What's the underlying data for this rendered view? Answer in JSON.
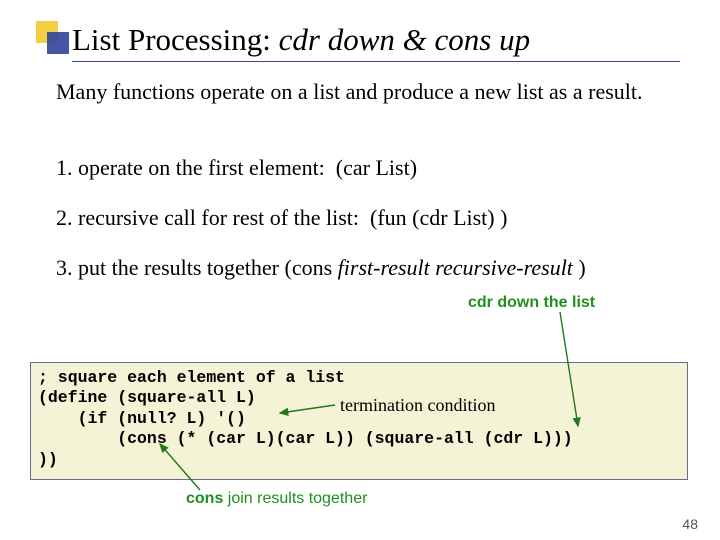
{
  "decor": {
    "yellow": "#f3cf45",
    "blue": "#37469c"
  },
  "title": {
    "plain": "List Processing: ",
    "italic": "cdr down & cons up"
  },
  "intro": "Many functions operate on a list and produce a new list as a result.",
  "steps": {
    "s1": "1. operate on the first element:  (car List)",
    "s2": "2. recursive call for rest of the list:  (fun (cdr List) )",
    "s3_pre": "3. put the results together (cons ",
    "s3_it": "first-result recursive-result",
    "s3_post": " )"
  },
  "labels": {
    "cdr": "cdr down the list",
    "cons_b": "cons",
    "cons_rest": " join results together"
  },
  "annot": {
    "term": "termination condition"
  },
  "code": "; square each element of a list\n(define (square-all L)\n    (if (null? L) '()\n        (cons (* (car L)(car L)) (square-all (cdr L)))\n))",
  "page": "48"
}
